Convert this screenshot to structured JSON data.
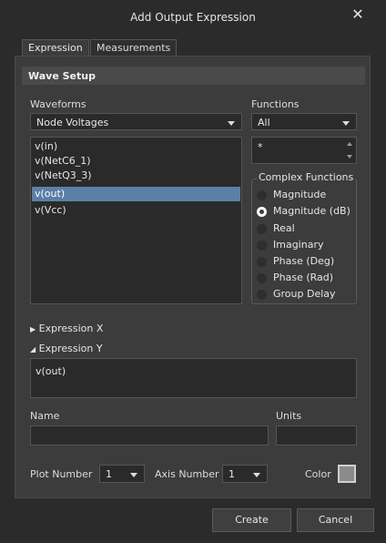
{
  "window": {
    "title": "Add Output Expression",
    "close_glyph": "✕"
  },
  "tabs": [
    {
      "label": "Expression",
      "active": true
    },
    {
      "label": "Measurements",
      "active": false
    }
  ],
  "wave_setup": {
    "header": "Wave Setup",
    "waveforms": {
      "label": "Waveforms",
      "selected": "Node Voltages",
      "items": [
        "v(in)",
        "v(NetC6_1)",
        "v(NetQ3_3)",
        "v(out)",
        "v(Vcc)"
      ],
      "selected_index": 3
    },
    "functions": {
      "label": "Functions",
      "selected": "All",
      "field_value": "*"
    },
    "complex_functions": {
      "title": "Complex Functions",
      "options": [
        "Magnitude",
        "Magnitude (dB)",
        "Real",
        "Imaginary",
        "Phase (Deg)",
        "Phase (Rad)",
        "Group Delay"
      ],
      "selected_index": 1
    }
  },
  "expression_x": {
    "label": "Expression X",
    "expanded": false
  },
  "expression_y": {
    "label": "Expression Y",
    "expanded": true,
    "value": "v(out)"
  },
  "name_field": {
    "label": "Name",
    "value": ""
  },
  "units_field": {
    "label": "Units",
    "value": ""
  },
  "plot_number": {
    "label": "Plot Number",
    "value": "1"
  },
  "axis_number": {
    "label": "Axis Number",
    "value": "1"
  },
  "color": {
    "label": "Color",
    "value": "#8a8a8a"
  },
  "buttons": {
    "create": "Create",
    "cancel": "Cancel"
  }
}
